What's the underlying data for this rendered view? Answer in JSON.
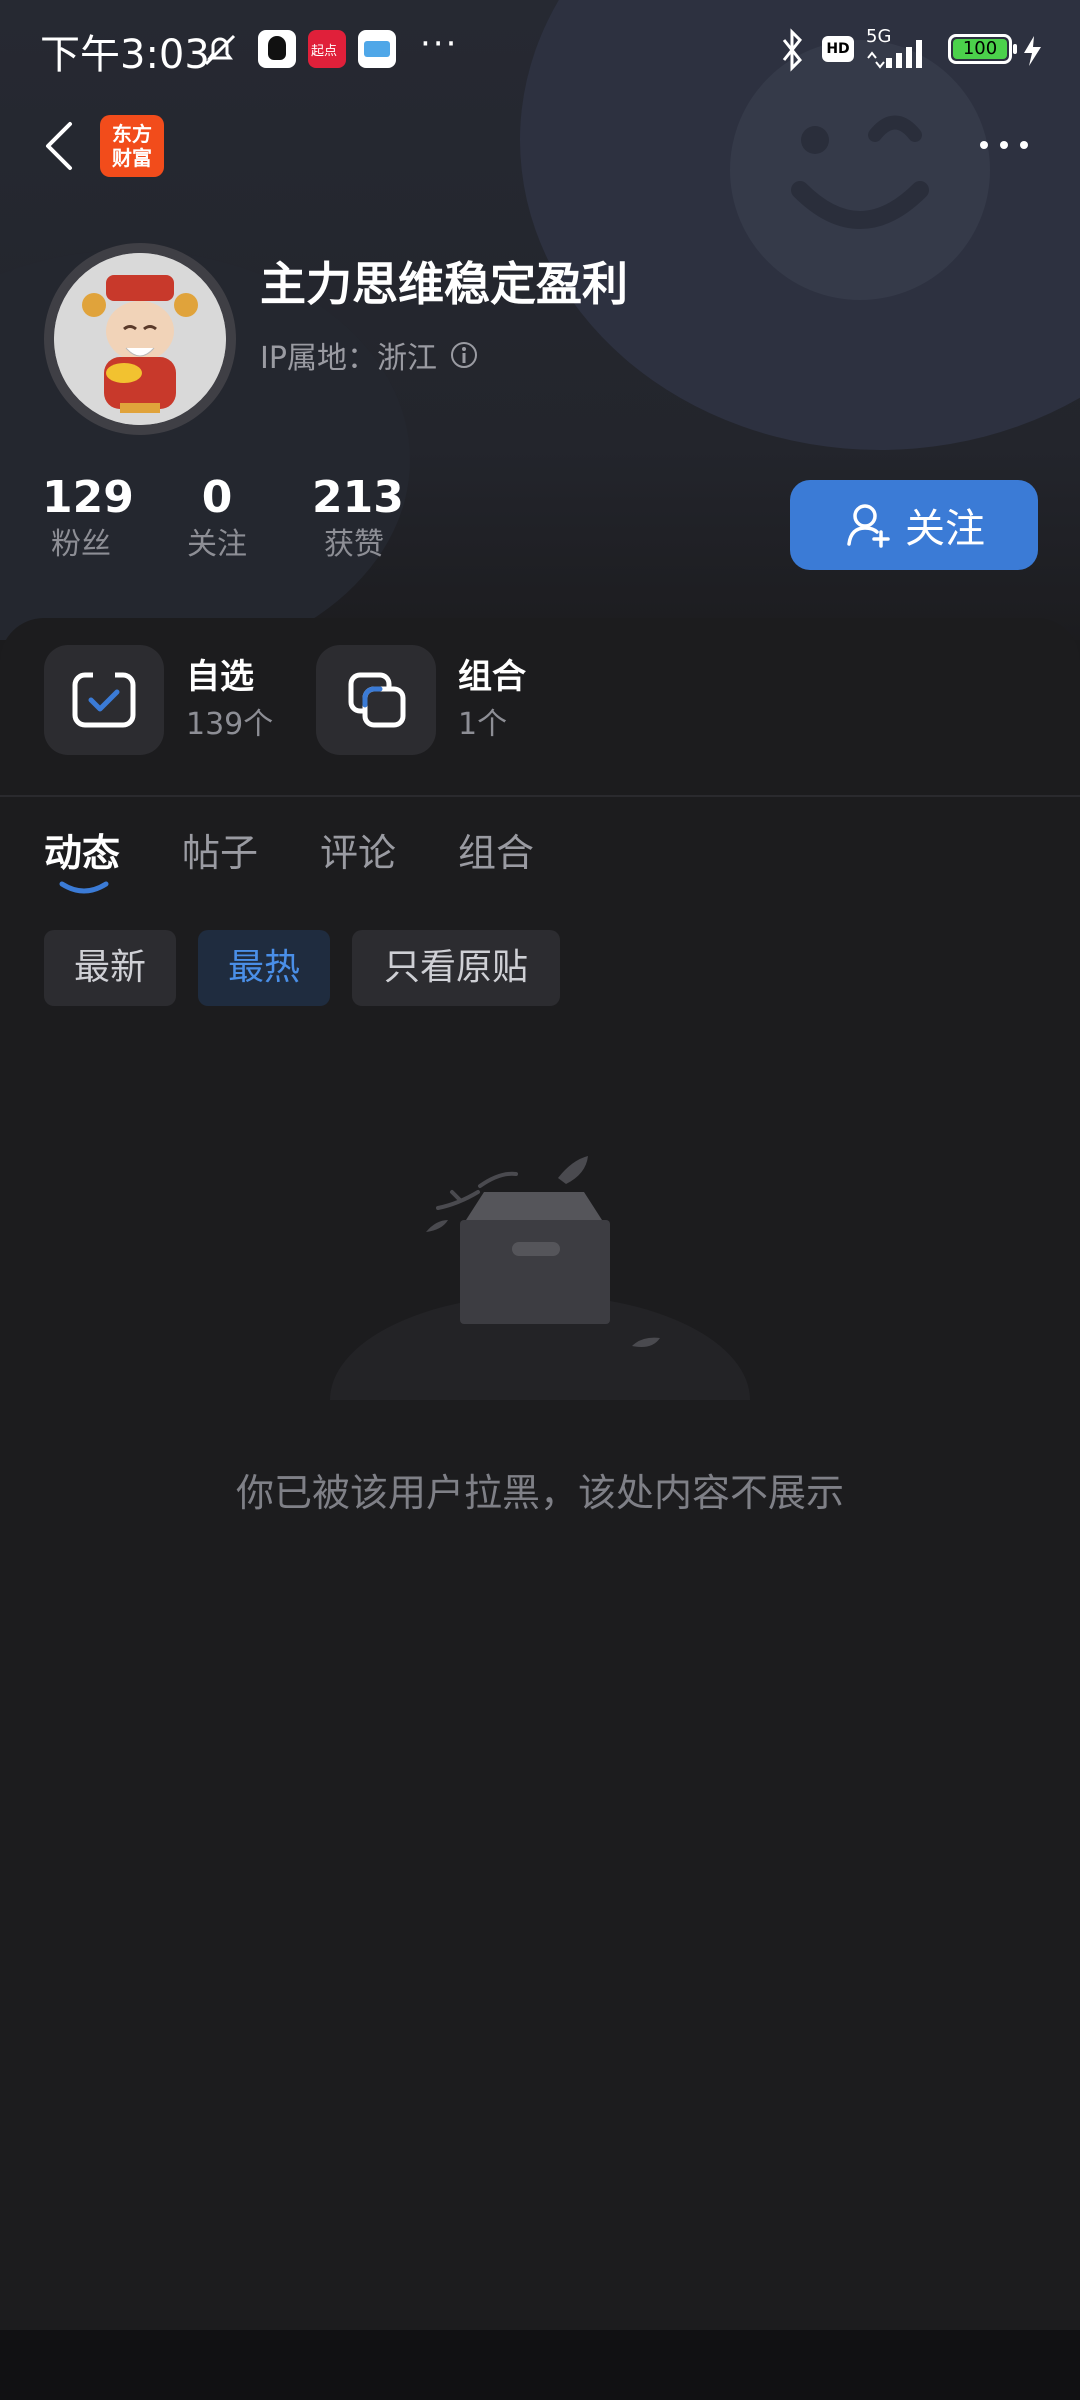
{
  "status_bar": {
    "time": "下午3:03",
    "overflow": "···",
    "network": "5G",
    "hd": "HD",
    "battery": "100"
  },
  "nav": {
    "app_logo_line1": "东方",
    "app_logo_line2": "财富"
  },
  "profile": {
    "username": "主力思维稳定盈利",
    "ip_label": "IP属地：",
    "ip_value": "浙江",
    "stats": [
      {
        "value": "129",
        "label": "粉丝"
      },
      {
        "value": "0",
        "label": "关注"
      },
      {
        "value": "213",
        "label": "获赞"
      }
    ],
    "follow_label": "关注"
  },
  "shortcuts": [
    {
      "title": "自选",
      "sub": "139个"
    },
    {
      "title": "组合",
      "sub": "1个"
    }
  ],
  "tabs": [
    "动态",
    "帖子",
    "评论",
    "组合"
  ],
  "active_tab": "动态",
  "filters": [
    "最新",
    "最热",
    "只看原贴"
  ],
  "active_filter": "最热",
  "empty_message": "你已被该用户拉黑，该处内容不展示",
  "colors": {
    "accent": "#3b7bd6",
    "background": "#1c1c1e",
    "logo": "#f24c1b"
  }
}
